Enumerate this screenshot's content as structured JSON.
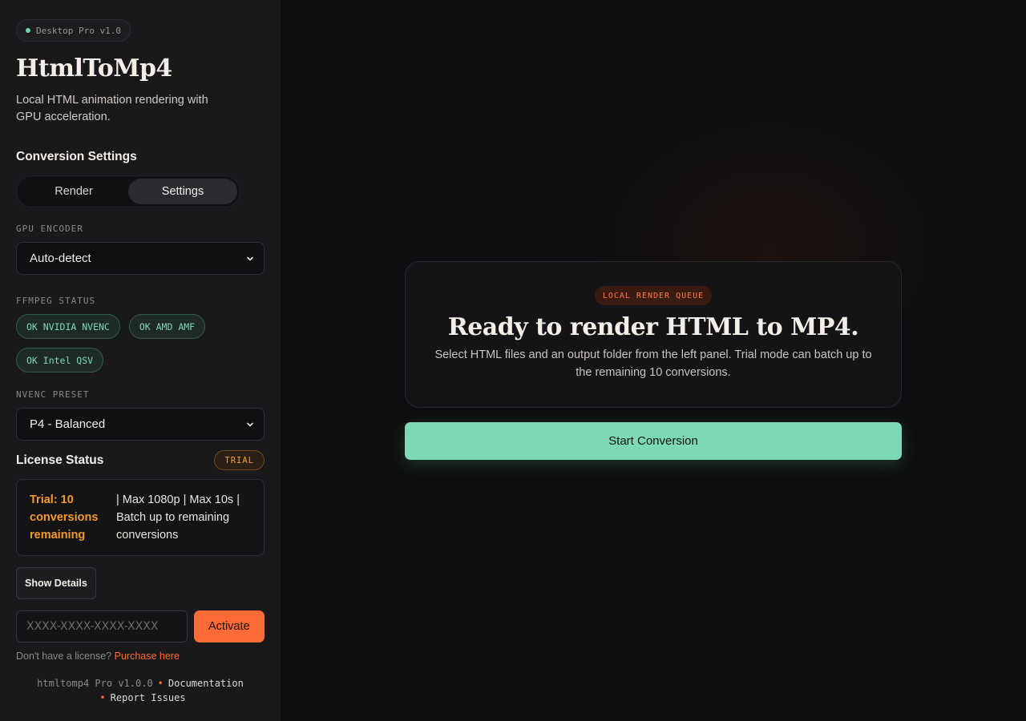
{
  "sidebar": {
    "version_pill": "Desktop Pro v1.0",
    "title": "HtmlToMp4",
    "subtitle": "Local HTML animation rendering with GPU acceleration.",
    "settings_title": "Conversion Settings",
    "tabs": [
      {
        "label": "Render",
        "active": false
      },
      {
        "label": "Settings",
        "active": true
      }
    ],
    "gpu_encoder": {
      "label": "GPU ENCODER",
      "value": "Auto-detect"
    },
    "ffmpeg_status": {
      "label": "FFMPEG STATUS",
      "items": [
        "OK NVIDIA NVENC",
        "OK AMD AMF",
        "OK Intel QSV"
      ]
    },
    "nvenc_preset": {
      "label": "NVENC PRESET",
      "value": "P4 - Balanced"
    },
    "license": {
      "title": "License Status",
      "badge": "TRIAL",
      "trial_count": "Trial: 10 conversions remaining",
      "limits": "| Max 1080p | Max 10s | Batch up to remaining conversions"
    },
    "show_details_label": "Show Details",
    "license_key_placeholder": "XXXX-XXXX-XXXX-XXXX",
    "activate_label": "Activate",
    "purchase_prompt": "Don't have a license?",
    "purchase_link": "Purchase here",
    "footer": {
      "version": "htmltomp4 Pro v1.0.0",
      "documentation": "Documentation",
      "report": "Report Issues"
    }
  },
  "main": {
    "queue_badge": "LOCAL RENDER QUEUE",
    "heading": "Ready to render HTML to MP4.",
    "description": "Select HTML files and an output folder from the left panel. Trial mode can batch up to the remaining 10 conversions.",
    "start_label": "Start Conversion"
  },
  "colors": {
    "accent_orange": "#ff6b35",
    "accent_green": "#7dd9b5",
    "trial_amber": "#f39a2c"
  }
}
